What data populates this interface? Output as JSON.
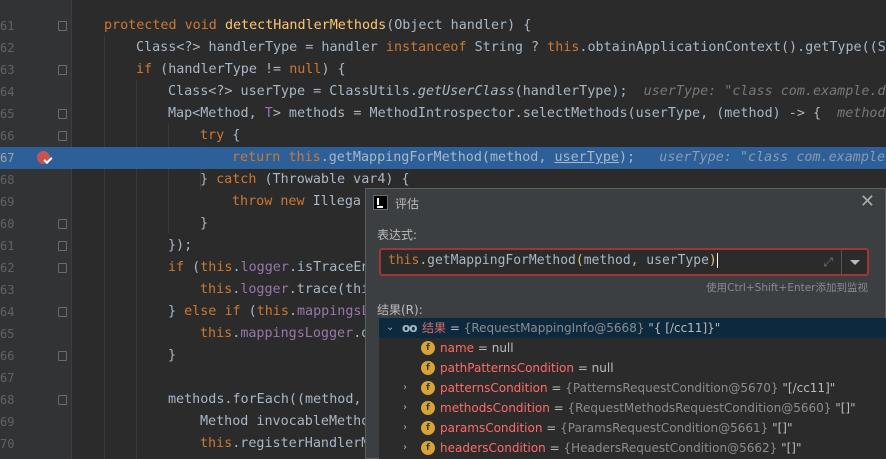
{
  "editor": {
    "lines": [
      {
        "num": "61"
      },
      {
        "num": "62"
      },
      {
        "num": "63"
      },
      {
        "num": "64"
      },
      {
        "num": "65"
      },
      {
        "num": "66"
      },
      {
        "num": "67"
      },
      {
        "num": "68"
      },
      {
        "num": "69"
      },
      {
        "num": "60"
      },
      {
        "num": "61"
      },
      {
        "num": "62"
      },
      {
        "num": "63"
      },
      {
        "num": "64"
      },
      {
        "num": "65"
      },
      {
        "num": "66"
      },
      {
        "num": "67"
      },
      {
        "num": "68"
      },
      {
        "num": "69"
      },
      {
        "num": "70"
      }
    ],
    "code": {
      "l1_protected": "protected",
      "l1_void": "void",
      "l1_name": "detectHandlerMethods",
      "l1_rest": "(Object handler) {",
      "l2_a": "Class<?> handlerType = handler ",
      "l2_instanceof": "instanceof",
      "l2_b": " String ? ",
      "l2_this": "this",
      "l2_c": ".obtainApplicationContext().getType((St",
      "l3_if": "if",
      "l3_a": " (handlerType != ",
      "l3_null": "null",
      "l3_b": ") {",
      "l4_a": "Class<?> userType = ClassUtils.",
      "l4_getUserClass": "getUserClass",
      "l4_b": "(handlerType);",
      "l4_hint": "userType: \"class com.example.de",
      "l5_a": "Map<Method, ",
      "l5_T": "T",
      "l5_b": "> methods = MethodIntrospector.selectMethods(userType, (method) -> {",
      "l5_hint": "method",
      "l6_try": "try",
      "l6_brace": " {",
      "l7_return": "return",
      "l7_this": "this",
      "l7_a": ".getMappingForMethod(method, ",
      "l7_userType": "userType",
      "l7_b": ");",
      "l7_hint": "userType: \"class com.example.d",
      "l8_a": "} ",
      "l8_catch": "catch",
      "l8_b": " (Throwable var4) {",
      "l9_throw": "throw",
      "l9_new": "new",
      "l9_a": " Illega",
      "l10_a": "}",
      "l11_a": "});",
      "l12_if": "if",
      "l12_a": " (",
      "l12_this": "this",
      "l12_b": ".",
      "l12_logger": "logger",
      "l12_c": ".isTraceEn",
      "l13_this": "this",
      "l13_a": ".",
      "l13_logger": "logger",
      "l13_b": ".trace(thi",
      "l14_a": "} ",
      "l14_else": "else",
      "l14_if": "if",
      "l14_b": " (",
      "l14_this": "this",
      "l14_c": ".",
      "l14_ml": "mappingsL",
      "l15_this": "this",
      "l15_a": ".",
      "l15_ml": "mappingsLogger",
      "l15_b": ".d",
      "l16_a": "}",
      "l18_a": "methods.forEach((method,",
      "l19_a": "Method invocableMetho",
      "l20_this": "this",
      "l20_a": ".registerHandlerM"
    }
  },
  "dialog": {
    "title": "评估",
    "expression_label": "表达式:",
    "expression_value": "this.getMappingForMethod(method, userType)",
    "shortcut_hint": "使用Ctrl+Shift+Enter添加到监视",
    "result_label": "结果(R):",
    "result": {
      "name": "结果",
      "eq": " = ",
      "type": "{RequestMappingInfo@5668}",
      "value": " \"{ [/cc11]}\""
    },
    "fields": [
      {
        "name": "name",
        "eq": " = ",
        "type": "",
        "value": "null",
        "expandable": false
      },
      {
        "name": "pathPatternsCondition",
        "eq": " = ",
        "type": "",
        "value": "null",
        "expandable": false
      },
      {
        "name": "patternsCondition",
        "eq": " = ",
        "type": "{PatternsRequestCondition@5670}",
        "value": " \"[/cc11]\"",
        "expandable": true
      },
      {
        "name": "methodsCondition",
        "eq": " = ",
        "type": "{RequestMethodsRequestCondition@5660}",
        "value": " \"[]\"",
        "expandable": true
      },
      {
        "name": "paramsCondition",
        "eq": " = ",
        "type": "{ParamsRequestCondition@5661}",
        "value": " \"[]\"",
        "expandable": true
      },
      {
        "name": "headersCondition",
        "eq": " = ",
        "type": "{HeadersRequestCondition@5662}",
        "value": " \"[]\"",
        "expandable": true
      }
    ]
  }
}
